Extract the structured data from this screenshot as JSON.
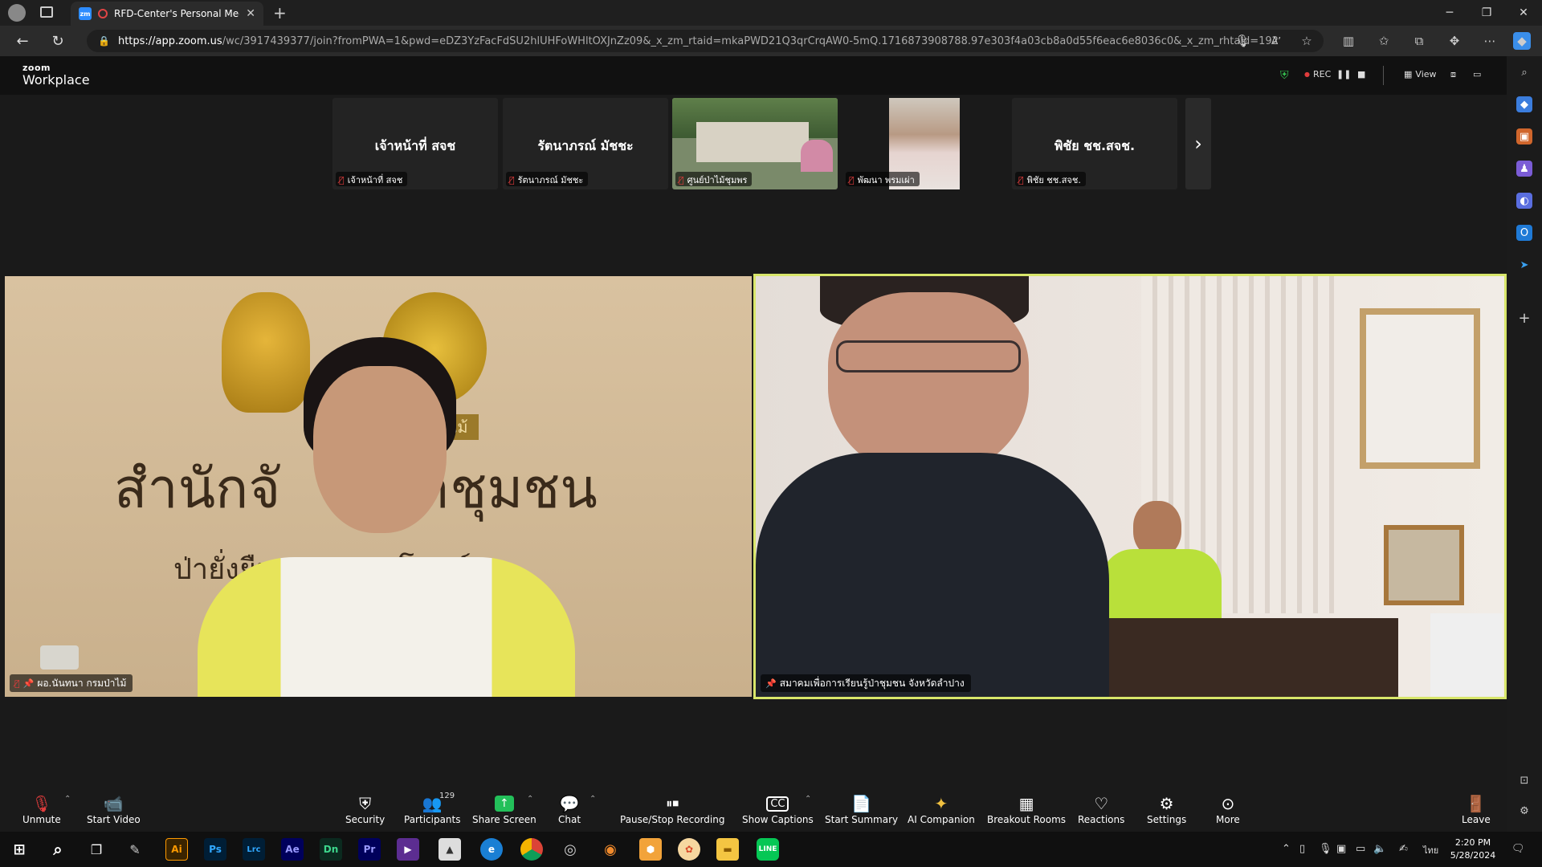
{
  "browser": {
    "tab_title": "RFD-Center's Personal Meet",
    "tab_icon_label": "zm",
    "url_host": "https://app.zoom.us",
    "url_path": "/wc/3917439377/join?fromPWA=1&pwd=eDZ3YzFacFdSU2hlUHFoWHltOXJnZz09&_x_zm_rtaid=mkaPWD21Q3qrCrqAW0-5mQ.1716873908788.97e303f4a03cb8a0d55f6eac6e8036c0&_x_zm_rhtaid=192",
    "reading_label": "A’"
  },
  "header": {
    "logo_top": "zoom",
    "logo_bottom": "Workplace",
    "rec_label": "REC",
    "view_label": "View"
  },
  "thumbnails": [
    {
      "big_name": "เจ้าหน้าที่ สจช",
      "label": "เจ้าหน้าที่ สจช"
    },
    {
      "big_name": "รัตนาภรณ์ มัชชะ",
      "label": "รัตนาภรณ์ มัชชะ"
    },
    {
      "big_name": "",
      "label": "ศูนย์ป่าไม้ชุมพร"
    },
    {
      "big_name": "",
      "label": "พัฒนา พรมเผ่า"
    },
    {
      "big_name": "พิชัย ชช.สจช.",
      "label": "พิชัย ชช.สจช."
    }
  ],
  "videos": {
    "left": {
      "label": "ผอ.นันทนา กรมป่าไม้",
      "banner_line1": "สำนักจั        าชุมชน",
      "banner_line2": "ป่ายั่งยืน        ประโยชน์",
      "emblem_text": "ไม้"
    },
    "right": {
      "label": "สมาคมเพื่อการเรียนรู้ป่าชุมชน จังหวัดลำปาง"
    }
  },
  "toolbar": {
    "unmute": "Unmute",
    "start_video": "Start Video",
    "security": "Security",
    "participants": "Participants",
    "participant_count": "129",
    "share_screen": "Share Screen",
    "chat": "Chat",
    "pause_stop": "Pause/Stop Recording",
    "show_captions": "Show Captions",
    "start_summary": "Start Summary",
    "ai_companion": "AI Companion",
    "breakout_rooms": "Breakout Rooms",
    "reactions": "Reactions",
    "settings": "Settings",
    "more": "More",
    "leave": "Leave"
  },
  "taskbar": {
    "apps": [
      "Ai",
      "Ps",
      "Lrc",
      "Ae",
      "Dn",
      "Pr"
    ],
    "language": "ไทย",
    "time": "2:20 PM",
    "date": "5/28/2024"
  },
  "colors": {
    "active_speaker_border": "#d8e66a",
    "mute_red": "#e03c3c",
    "share_green": "#23c05a"
  }
}
